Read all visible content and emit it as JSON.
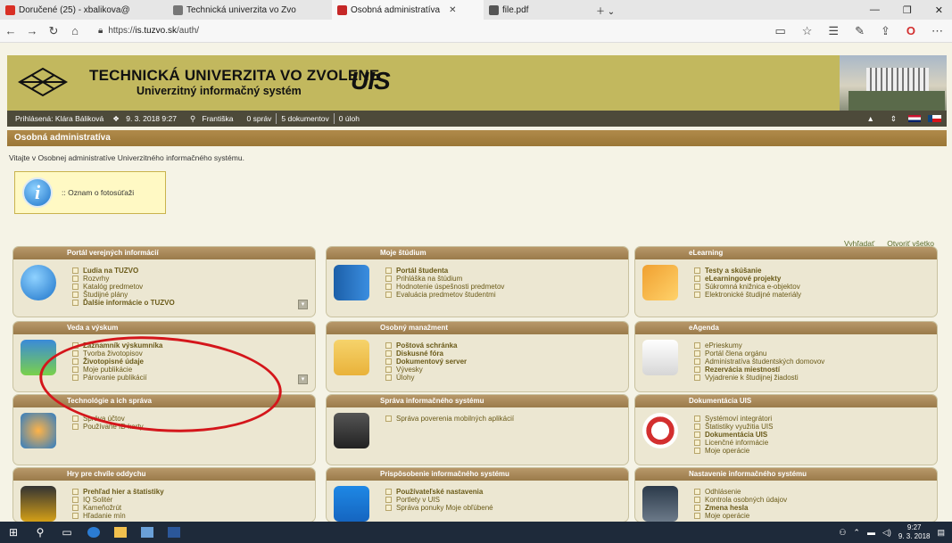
{
  "browser": {
    "tabs": [
      {
        "label": "Doručené (25) - xbalikova@",
        "color": "#d93025"
      },
      {
        "label": "Technická univerzita vo Zvo",
        "color": "#777777"
      },
      {
        "label": "Osobná administratíva",
        "color": "#c62828",
        "active": true
      },
      {
        "label": "file.pdf",
        "color": "#555555"
      }
    ],
    "url_prefix": "https://",
    "url_host": "is.tuzvo.sk",
    "url_path": "/auth/"
  },
  "header": {
    "university": "TECHNICKÁ UNIVERZITA VO ZVOLENE",
    "subtitle": "Univerzitný informačný systém",
    "logo_text": "UIS"
  },
  "status": {
    "user": "Prihlásená: Klára Báliková",
    "datetime": "9. 3. 2018 9:27",
    "name_day": "Františka",
    "messages": "0 správ",
    "documents": "5 dokumentov",
    "tasks": "0 úloh"
  },
  "section_title": "Osobná administratíva",
  "welcome": "Vitajte v Osobnej administratíve Univerzitného informačného systému.",
  "notice": ":: Oznam o fotosúťaži",
  "top_links": {
    "search": "Vyhľadať",
    "open_all": "Otvoriť všetko"
  },
  "portlets": [
    {
      "title": "Portál verejných informácií",
      "items": [
        {
          "t": "Ľudia na TUZVO",
          "b": true
        },
        {
          "t": "Rozvrhy"
        },
        {
          "t": "Katalóg predmetov"
        },
        {
          "t": "Študijné plány"
        },
        {
          "t": "Ďalšie informácie o TUZVO",
          "b": true
        }
      ],
      "icon": "info-icon"
    },
    {
      "title": "Moje štúdium",
      "items": [
        {
          "t": "Portál študenta",
          "b": true
        },
        {
          "t": "Prihláška na štúdium"
        },
        {
          "t": "Hodnotenie úspešnosti predmetov"
        },
        {
          "t": "Evaluácia predmetov študentmi"
        }
      ],
      "icon": "book-icon"
    },
    {
      "title": "eLearning",
      "items": [
        {
          "t": "Testy a skúšanie",
          "b": true
        },
        {
          "t": "eLearningové projekty",
          "b": true
        },
        {
          "t": "Súkromná knižnica e-objektov"
        },
        {
          "t": "Elektronické študijné materiály"
        }
      ],
      "icon": "elearning-icon"
    },
    {
      "title": "Veda a výskum",
      "items": [
        {
          "t": "Záznamník výskumníka",
          "b": true
        },
        {
          "t": "Tvorba životopisov"
        },
        {
          "t": "Životopisné údaje",
          "b": true
        },
        {
          "t": "Moje publikácie"
        },
        {
          "t": "Párovanie publikácií"
        }
      ],
      "icon": "flask-icon"
    },
    {
      "title": "Osobný manažment",
      "items": [
        {
          "t": "Poštová schránka",
          "b": true
        },
        {
          "t": "Diskusné fóra",
          "b": true
        },
        {
          "t": "Dokumentový server",
          "b": true
        },
        {
          "t": "Vývesky"
        },
        {
          "t": "Úlohy"
        }
      ],
      "icon": "envelope-icon"
    },
    {
      "title": "eAgenda",
      "items": [
        {
          "t": "ePrieskumy"
        },
        {
          "t": "Portál člena orgánu"
        },
        {
          "t": "Administratíva študentských domovov"
        },
        {
          "t": "Rezervácia miestností",
          "b": true
        },
        {
          "t": "Vyjadrenie k študijnej žiadosti"
        }
      ],
      "icon": "document-pen-icon"
    },
    {
      "title": "Technológie a ich správa",
      "items": [
        {
          "t": "Správa účtov"
        },
        {
          "t": "Používané ID karty"
        }
      ],
      "icon": "gears-icon"
    },
    {
      "title": "Správa informačného systému",
      "items": [
        {
          "t": "Správa poverenia mobilných aplikácií"
        }
      ],
      "icon": "editor-icon"
    },
    {
      "title": "Dokumentácia UIS",
      "items": [
        {
          "t": "Systémoví integrátori"
        },
        {
          "t": "Štatistiky využitia UIS"
        },
        {
          "t": "Dokumentácia UIS",
          "b": true
        },
        {
          "t": "Licenčné informácie"
        },
        {
          "t": "Moje operácie"
        }
      ],
      "icon": "lifebuoy-icon"
    },
    {
      "title": "Hry pre chvíle oddychu",
      "items": [
        {
          "t": "Prehľad hier a štatistiky",
          "b": true
        },
        {
          "t": "IQ Solitér"
        },
        {
          "t": "Kameňožrút"
        },
        {
          "t": "Hľadanie mín"
        }
      ],
      "icon": "slot-machine-icon"
    },
    {
      "title": "Prispôsobenie informačného systému",
      "items": [
        {
          "t": "Používateľské nastavenia",
          "b": true
        },
        {
          "t": "Portlety v UIS"
        },
        {
          "t": "Správa ponuky Moje obľúbené"
        }
      ],
      "icon": "toggles-icon"
    },
    {
      "title": "Nastavenie informačného systému",
      "items": [
        {
          "t": "Odhlásenie"
        },
        {
          "t": "Kontrola osobných údajov"
        },
        {
          "t": "Zmena hesla",
          "b": true
        },
        {
          "t": "Moje operácie"
        }
      ],
      "icon": "computer-icon"
    }
  ],
  "taskbar": {
    "time": "9:27",
    "date": "9. 3. 2018"
  }
}
